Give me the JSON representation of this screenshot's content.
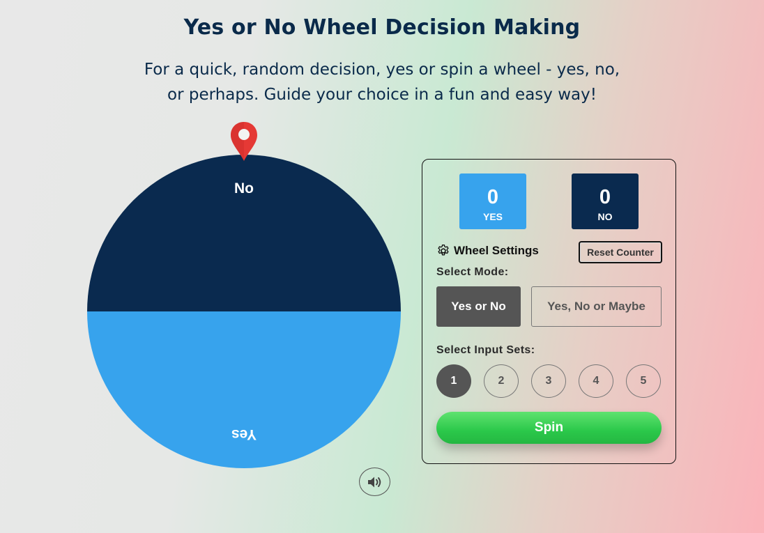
{
  "header": {
    "title": "Yes or No Wheel Decision Making",
    "subtitle": "For a quick, random decision, yes or spin a wheel - yes, no, or perhaps. Guide your choice in a fun and easy way!"
  },
  "wheel": {
    "segments": [
      {
        "label": "No",
        "color": "#0a2a4f"
      },
      {
        "label": "Yes",
        "color": "#37a3ed"
      }
    ],
    "pointer_color": "#e53935"
  },
  "counters": {
    "yes": {
      "value": "0",
      "label": "YES",
      "color": "#37a3ed"
    },
    "no": {
      "value": "0",
      "label": "NO",
      "color": "#0a2a4f"
    }
  },
  "settings": {
    "heading": "Wheel Settings",
    "reset_label": "Reset Counter",
    "mode_label": "Select Mode:",
    "modes": [
      "Yes or No",
      "Yes, No or Maybe"
    ],
    "selected_mode": "Yes or No",
    "input_sets_label": "Select Input Sets:",
    "input_sets": [
      "1",
      "2",
      "3",
      "4",
      "5"
    ],
    "selected_set": "1",
    "spin_label": "Spin"
  },
  "icons": {
    "pointer": "map-pin-icon",
    "settings": "gear-icon",
    "sound": "speaker-icon"
  }
}
